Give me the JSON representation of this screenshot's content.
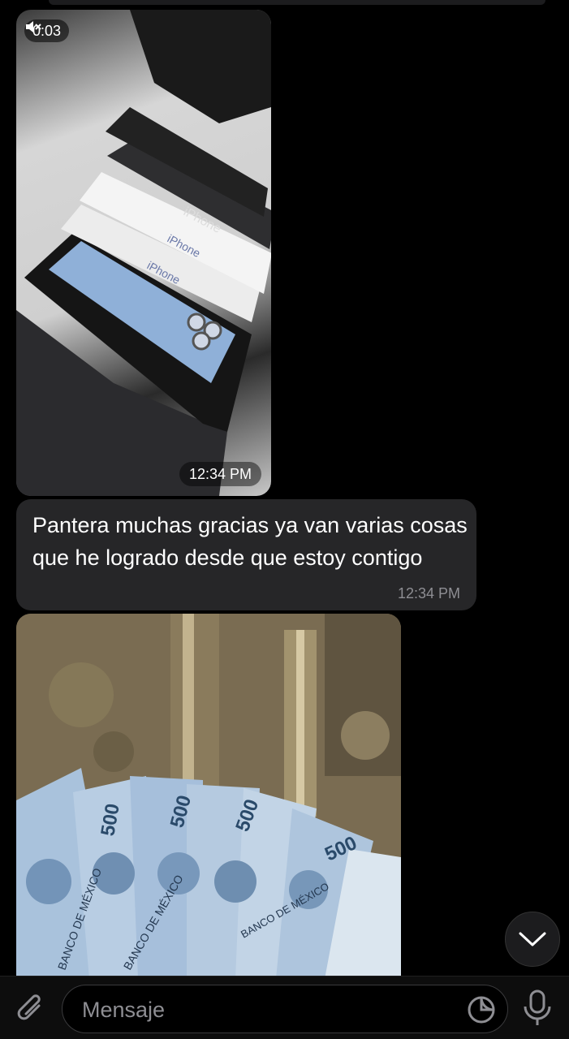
{
  "video_message": {
    "duration": "0:03",
    "time": "12:34 PM",
    "box_labels": [
      "iPhone",
      "iPhone",
      "iPhone"
    ],
    "icons": {
      "mute": "speaker-muted-icon"
    }
  },
  "text_message": {
    "text": "Pantera muchas gracias ya van varias cosas que he logrado desde que estoy contigo",
    "time": "12:34 PM"
  },
  "photo_message": {
    "banknote_value": "500",
    "banknote_bank": "BANCO DE MÉXICO"
  },
  "composer": {
    "placeholder": "Mensaje",
    "icons": {
      "attach": "paperclip-icon",
      "sticker": "sticker-icon",
      "mic": "microphone-icon",
      "scroll": "chevron-down-icon"
    }
  },
  "colors": {
    "background": "#000000",
    "bubble": "#262628",
    "timestamp": "#8e8e93"
  }
}
